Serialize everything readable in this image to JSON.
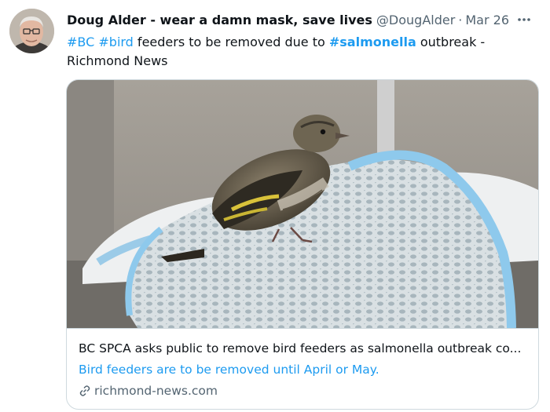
{
  "tweet": {
    "author_name": "Doug Alder - wear a damn mask, save lives",
    "handle": "@DougAlder",
    "separator": "·",
    "date": "Mar 26",
    "more_label": "···",
    "text": {
      "tag1": "#BC",
      "tag2": "#bird",
      "middle": " feeders to be removed due to ",
      "tag3": "#salmonella",
      "end": " outbreak - Richmond News"
    }
  },
  "card": {
    "title": "BC SPCA asks public to remove bird feeders as salmonella outbreak co...",
    "description": "Bird feeders are to be removed until April or May.",
    "domain": "richmond-news.com"
  },
  "icons": {
    "more": "more-dots-icon",
    "link": "link-icon"
  },
  "colors": {
    "accent": "#1d9bf0",
    "text": "#0f1419",
    "secondary": "#536471",
    "border": "#cfd9de"
  }
}
